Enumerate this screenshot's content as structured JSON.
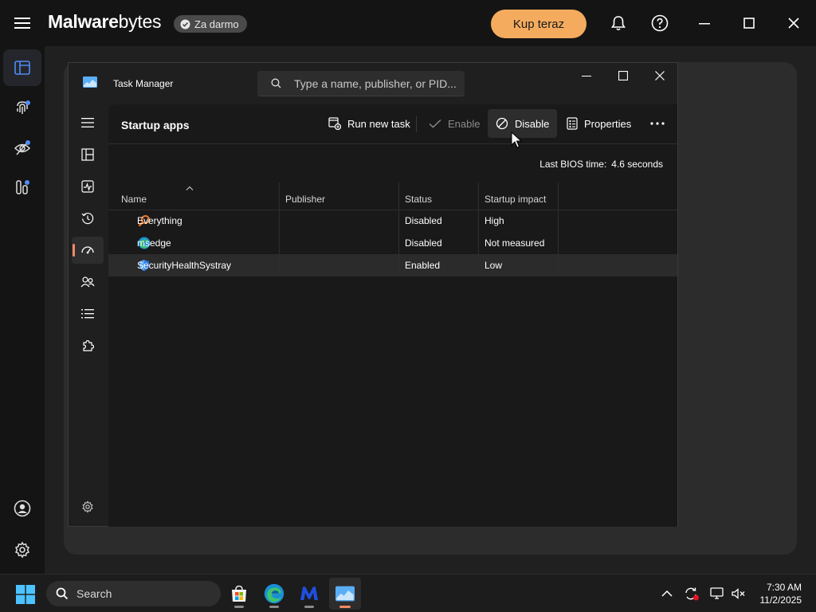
{
  "malwarebytes": {
    "logo_bold": "Malware",
    "logo_rest": "bytes",
    "badge": "Za darmo",
    "buy_button": "Kup teraz"
  },
  "task_manager": {
    "title": "Task Manager",
    "search_placeholder": "Type a name, publisher, or PID...",
    "page_title": "Startup apps",
    "toolbar": {
      "run_new_task": "Run new task",
      "enable": "Enable",
      "disable": "Disable",
      "properties": "Properties"
    },
    "bios_label": "Last BIOS time:",
    "bios_value": "4.6 seconds",
    "columns": [
      "Name",
      "Publisher",
      "Status",
      "Startup impact"
    ],
    "rows": [
      {
        "name": "Everything",
        "publisher": "",
        "status": "Disabled",
        "impact": "High",
        "icon": "magnifier-icon"
      },
      {
        "name": "msedge",
        "publisher": "",
        "status": "Disabled",
        "impact": "Not measured",
        "icon": "edge-icon"
      },
      {
        "name": "SecurityHealthSystray",
        "publisher": "",
        "status": "Enabled",
        "impact": "Low",
        "icon": "shield-icon"
      }
    ]
  },
  "taskbar": {
    "search": "Search",
    "time": "7:30 AM",
    "date": "11/2/2025"
  },
  "colors": {
    "accent": "#f08a67",
    "buy_button": "#f5ab5e"
  }
}
